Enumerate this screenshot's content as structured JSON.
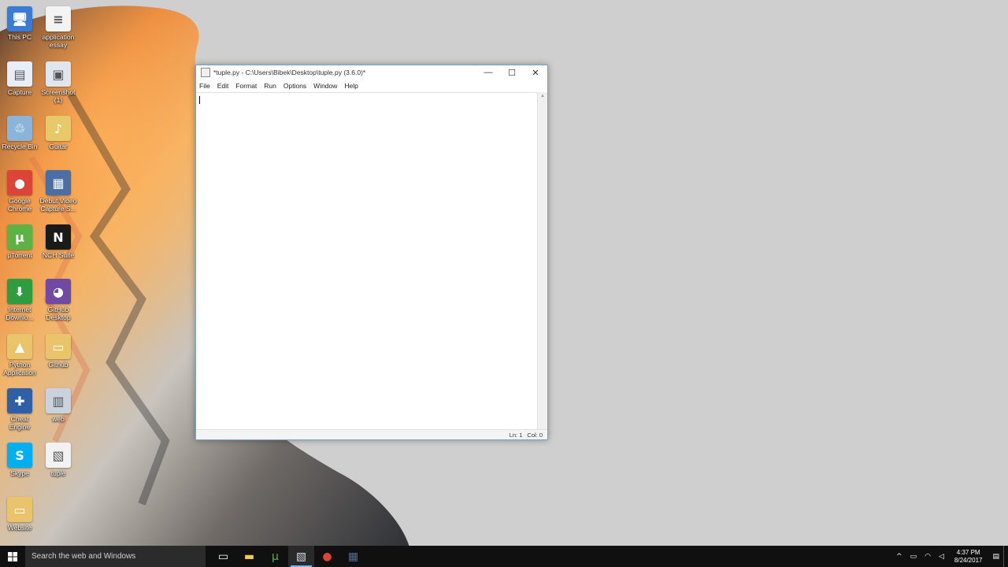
{
  "desktop": {
    "icons": [
      {
        "label": "This PC",
        "glyph": "🖥",
        "color": "#3a7bd5"
      },
      {
        "label": "application\nessay",
        "glyph": "≡",
        "color": "#f3f3f3"
      },
      {
        "label": "Capture",
        "glyph": "▤",
        "color": "#e8eef7"
      },
      {
        "label": "Screenshot\n(1)",
        "glyph": "▣",
        "color": "#dfe6ee"
      },
      {
        "label": "Recycle Bin",
        "glyph": "♲",
        "color": "#8ab4d8"
      },
      {
        "label": "Guitar",
        "glyph": "♪",
        "color": "#e8c96a"
      },
      {
        "label": "Google\nChrome",
        "glyph": "●",
        "color": "#db4437"
      },
      {
        "label": "Debut Video\nCapture S...",
        "glyph": "▦",
        "color": "#4a6fa5"
      },
      {
        "label": "µTorrent",
        "glyph": "µ",
        "color": "#5bb346"
      },
      {
        "label": "NCH Suite",
        "glyph": "N",
        "color": "#1a1a1a"
      },
      {
        "label": "Internet\nDownlo...",
        "glyph": "⬇",
        "color": "#2e9d3f"
      },
      {
        "label": "GitHub\nDesktop",
        "glyph": "◕",
        "color": "#6e4aa5"
      },
      {
        "label": "Python\nApplication",
        "glyph": "▲",
        "color": "#e9c46a"
      },
      {
        "label": "Github",
        "glyph": "▭",
        "color": "#e9c46a"
      },
      {
        "label": "Cheat Engine",
        "glyph": "✚",
        "color": "#2f5fa8"
      },
      {
        "label": "web",
        "glyph": "▥",
        "color": "#c8d3df"
      },
      {
        "label": "Skype",
        "glyph": "S",
        "color": "#00aff0"
      },
      {
        "label": "tuple",
        "glyph": "▧",
        "color": "#f2f2f2"
      },
      {
        "label": "Website",
        "glyph": "▭",
        "color": "#e9c46a"
      }
    ]
  },
  "window": {
    "title": "*tuple.py - C:\\Users\\Bibek\\Desktop\\tuple.py (3.6.0)*",
    "minimize": "—",
    "maximize": "☐",
    "close": "✕",
    "menu": [
      "File",
      "Edit",
      "Format",
      "Run",
      "Options",
      "Window",
      "Help"
    ],
    "status_line": "Ln: 1",
    "status_col": "Col: 0",
    "accent": "#7aa2c8"
  },
  "taskbar": {
    "search_placeholder": "Search the web and Windows",
    "apps": [
      {
        "name": "task-view",
        "glyph": "▭",
        "color": "#ffffff"
      },
      {
        "name": "file-explorer",
        "glyph": "▬",
        "color": "#f2c94c"
      },
      {
        "name": "utorrent",
        "glyph": "µ",
        "color": "#5bb346"
      },
      {
        "name": "idle",
        "glyph": "▧",
        "color": "#cfd8e3"
      },
      {
        "name": "chrome",
        "glyph": "●",
        "color": "#db4437"
      },
      {
        "name": "debut",
        "glyph": "▦",
        "color": "#4a6fa5"
      }
    ],
    "active_index": 3,
    "time": "4:37 PM",
    "date": "8/24/2017"
  }
}
